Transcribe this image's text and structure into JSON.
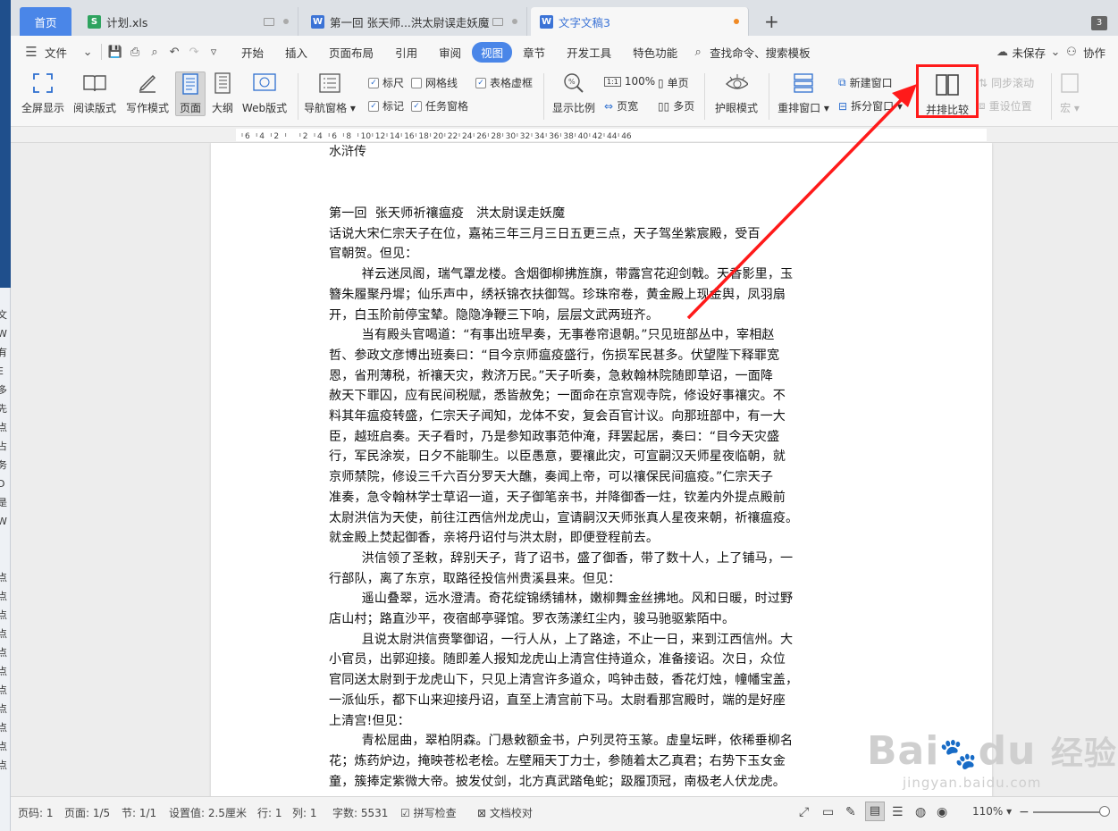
{
  "tabs": [
    {
      "label": "首页",
      "type": "home"
    },
    {
      "label": "计划.xls",
      "type": "sheet",
      "icon_color": "#2ea35f"
    },
    {
      "label": "第一回 张天师...洪太尉误走妖魔",
      "type": "doc",
      "icon_color": "#3b73d6"
    },
    {
      "label": "文字文稿3",
      "type": "doc",
      "icon_color": "#3b73d6",
      "active": true,
      "unsaved_dot_color": "#f08a24"
    }
  ],
  "tab_add": "+",
  "tab_count": "3",
  "menu": {
    "file": "文件",
    "items": [
      "开始",
      "插入",
      "页面布局",
      "引用",
      "审阅",
      "视图",
      "章节",
      "开发工具",
      "特色功能"
    ],
    "active_item": "视图",
    "search": "查找命令、搜索模板",
    "unsaved": "未保存",
    "collab": "协作"
  },
  "ribbon": {
    "fullscreen": "全屏显示",
    "read_mode": "阅读版式",
    "write_mode": "写作模式",
    "page": "页面",
    "outline": "大纲",
    "web": "Web版式",
    "nav_pane": "导航窗格",
    "ruler": "标尺",
    "gridlines": "网格线",
    "table_gridlines": "表格虚框",
    "marks": "标记",
    "task_pane": "任务窗格",
    "zoom": "显示比例",
    "zoom_100": "100%",
    "page_width": "页宽",
    "single_page": "单页",
    "multi_page": "多页",
    "eye_mode": "护眼模式",
    "arrange": "重排窗口",
    "new_window": "新建窗口",
    "split": "拆分窗口",
    "side_by_side": "并排比较",
    "sync_scroll": "同步滚动",
    "reset_pos": "重设位置",
    "macro": "宏"
  },
  "ruler_ticks": [
    "6",
    "4",
    "2",
    "",
    "2",
    "4",
    "6",
    "8",
    "10",
    "12",
    "14",
    "16",
    "18",
    "20",
    "22",
    "24",
    "26",
    "28",
    "30",
    "32",
    "34",
    "36",
    "38",
    "40",
    "42",
    "44",
    "46"
  ],
  "document": {
    "title": "水浒传",
    "body": "第一回  张天师祈禳瘟疫   洪太尉误走妖魔\n话说大宋仁宗天子在位，嘉祐三年三月三日五更三点，天子驾坐紫宸殿，受百\n官朝贺。但见：\n        祥云迷凤阁，瑞气罩龙楼。含烟御柳拂旌旗，带露宫花迎剑戟。天香影里，玉\n簪朱履聚丹墀；仙乐声中，绣袄锦衣扶御驾。珍珠帘卷，黄金殿上现金舆，凤羽扇\n开，白玉阶前停宝辇。隐隐净鞭三下响，层层文武两班齐。\n        当有殿头官喝道：“有事出班早奏，无事卷帘退朝。”只见班部丛中，宰相赵\n哲、参政文彦博出班奏曰：“目今京师瘟疫盛行，伤损军民甚多。伏望陛下释罪宽\n恩，省刑薄税，祈禳天灾，救济万民。”天子听奏，急敕翰林院随即草诏，一面降\n赦天下罪囚，应有民间税赋，悉皆赦免；一面命在京宫观寺院，修设好事禳灾。不\n料其年瘟疫转盛，仁宗天子闻知，龙体不安，复会百官计议。向那班部中，有一大\n臣，越班启奏。天子看时，乃是参知政事范仲淹，拜罢起居，奏曰：“目今天灾盛\n行，军民涂炭，日夕不能聊生。以臣愚意，要禳此灾，可宣嗣汉天师星夜临朝，就\n京师禁院，修设三千六百分罗天大醮，奏闻上帝，可以禳保民间瘟疫。”仁宗天子\n准奏，急令翰林学士草诏一道，天子御笔亲书，并降御香一炷，钦差内外提点殿前\n太尉洪信为天使，前往江西信州龙虎山，宣请嗣汉天师张真人星夜来朝，祈禳瘟疫。\n就金殿上焚起御香，亲将丹诏付与洪太尉，即便登程前去。\n        洪信领了圣敕，辞别天子，背了诏书，盛了御香，带了数十人，上了铺马，一\n行部队，离了东京，取路径投信州贵溪县来。但见：\n        遥山叠翠，远水澄清。奇花绽锦绣铺林，嫩柳舞金丝拂地。风和日暖，时过野\n店山村；路直沙平，夜宿邮亭驿馆。罗衣荡漾红尘内，骏马驰驱紫陌中。\n        且说太尉洪信赍擎御诏，一行人从，上了路途，不止一日，来到江西信州。大\n小官员，出郭迎接。随即差人报知龙虎山上清宫住持道众，准备接诏。次日，众位\n官同送太尉到于龙虎山下，只见上清宫许多道众，鸣钟击鼓，香花灯烛，幢幡宝盖，\n一派仙乐，都下山来迎接丹诏，直至上清宫前下马。太尉看那宫殿时，端的是好座\n上清宫!但见：\n        青松屈曲，翠柏阴森。门悬敕额金书，户列灵符玉篆。虚皇坛畔，依稀垂柳名\n花；炼药炉边，掩映苍松老桧。左壁厢天丁力士，参随着太乙真君；右势下玉女金\n童，簇捧定紫微大帝。披发仗剑，北方真武踏龟蛇；趿履顶冠，南极老人伏龙虎。"
  },
  "left_strip_chars": [
    "文",
    "W",
    "有",
    "E",
    "多",
    "先",
    "点",
    "占",
    "务",
    "D",
    "是",
    "W",
    "",
    "",
    "点",
    "点",
    "点",
    "点",
    "点",
    "点",
    "点",
    "点",
    "点",
    "点",
    "点"
  ],
  "watermark": {
    "logo": "Bai",
    "paw": "du",
    "brand": "经验",
    "url": "jingyan.baidu.com"
  },
  "status": {
    "page_num": "页码: 1",
    "pages": "页面: 1/5",
    "section": "节: 1/1",
    "setting": "设置值: 2.5厘米",
    "row": "行: 1",
    "col": "列: 1",
    "words": "字数: 5531",
    "spell": "拼写检查",
    "proof": "文档校对",
    "zoom": "110%"
  },
  "colors": {
    "accent": "#4a86e8",
    "highlight": "#ff1a1a"
  }
}
